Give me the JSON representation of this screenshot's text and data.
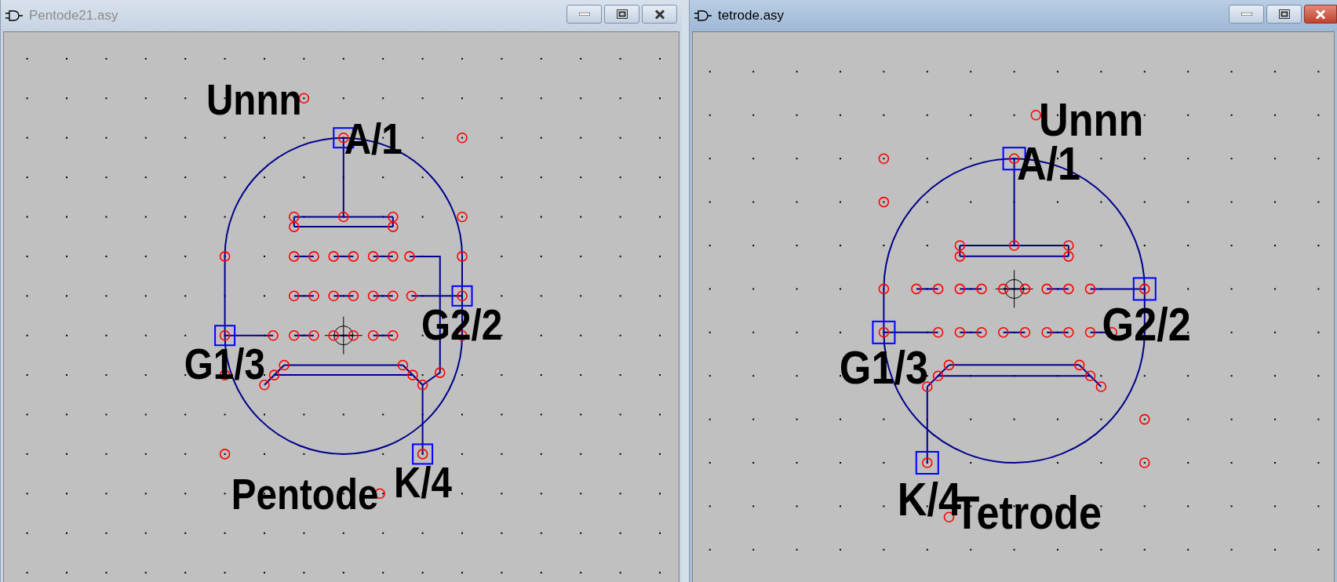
{
  "windows": [
    {
      "title": "Pentode21.asy",
      "active": false,
      "kind": "pentode",
      "labels": [
        "Unnn",
        "A/1",
        "G2/2",
        "G1/3",
        "K/4",
        "Pentode"
      ]
    },
    {
      "title": "tetrode.asy",
      "active": true,
      "kind": "tetrode",
      "labels": [
        "Unnn",
        "A/1",
        "G2/2",
        "G1/3",
        "K/4",
        "Tetrode"
      ]
    }
  ]
}
